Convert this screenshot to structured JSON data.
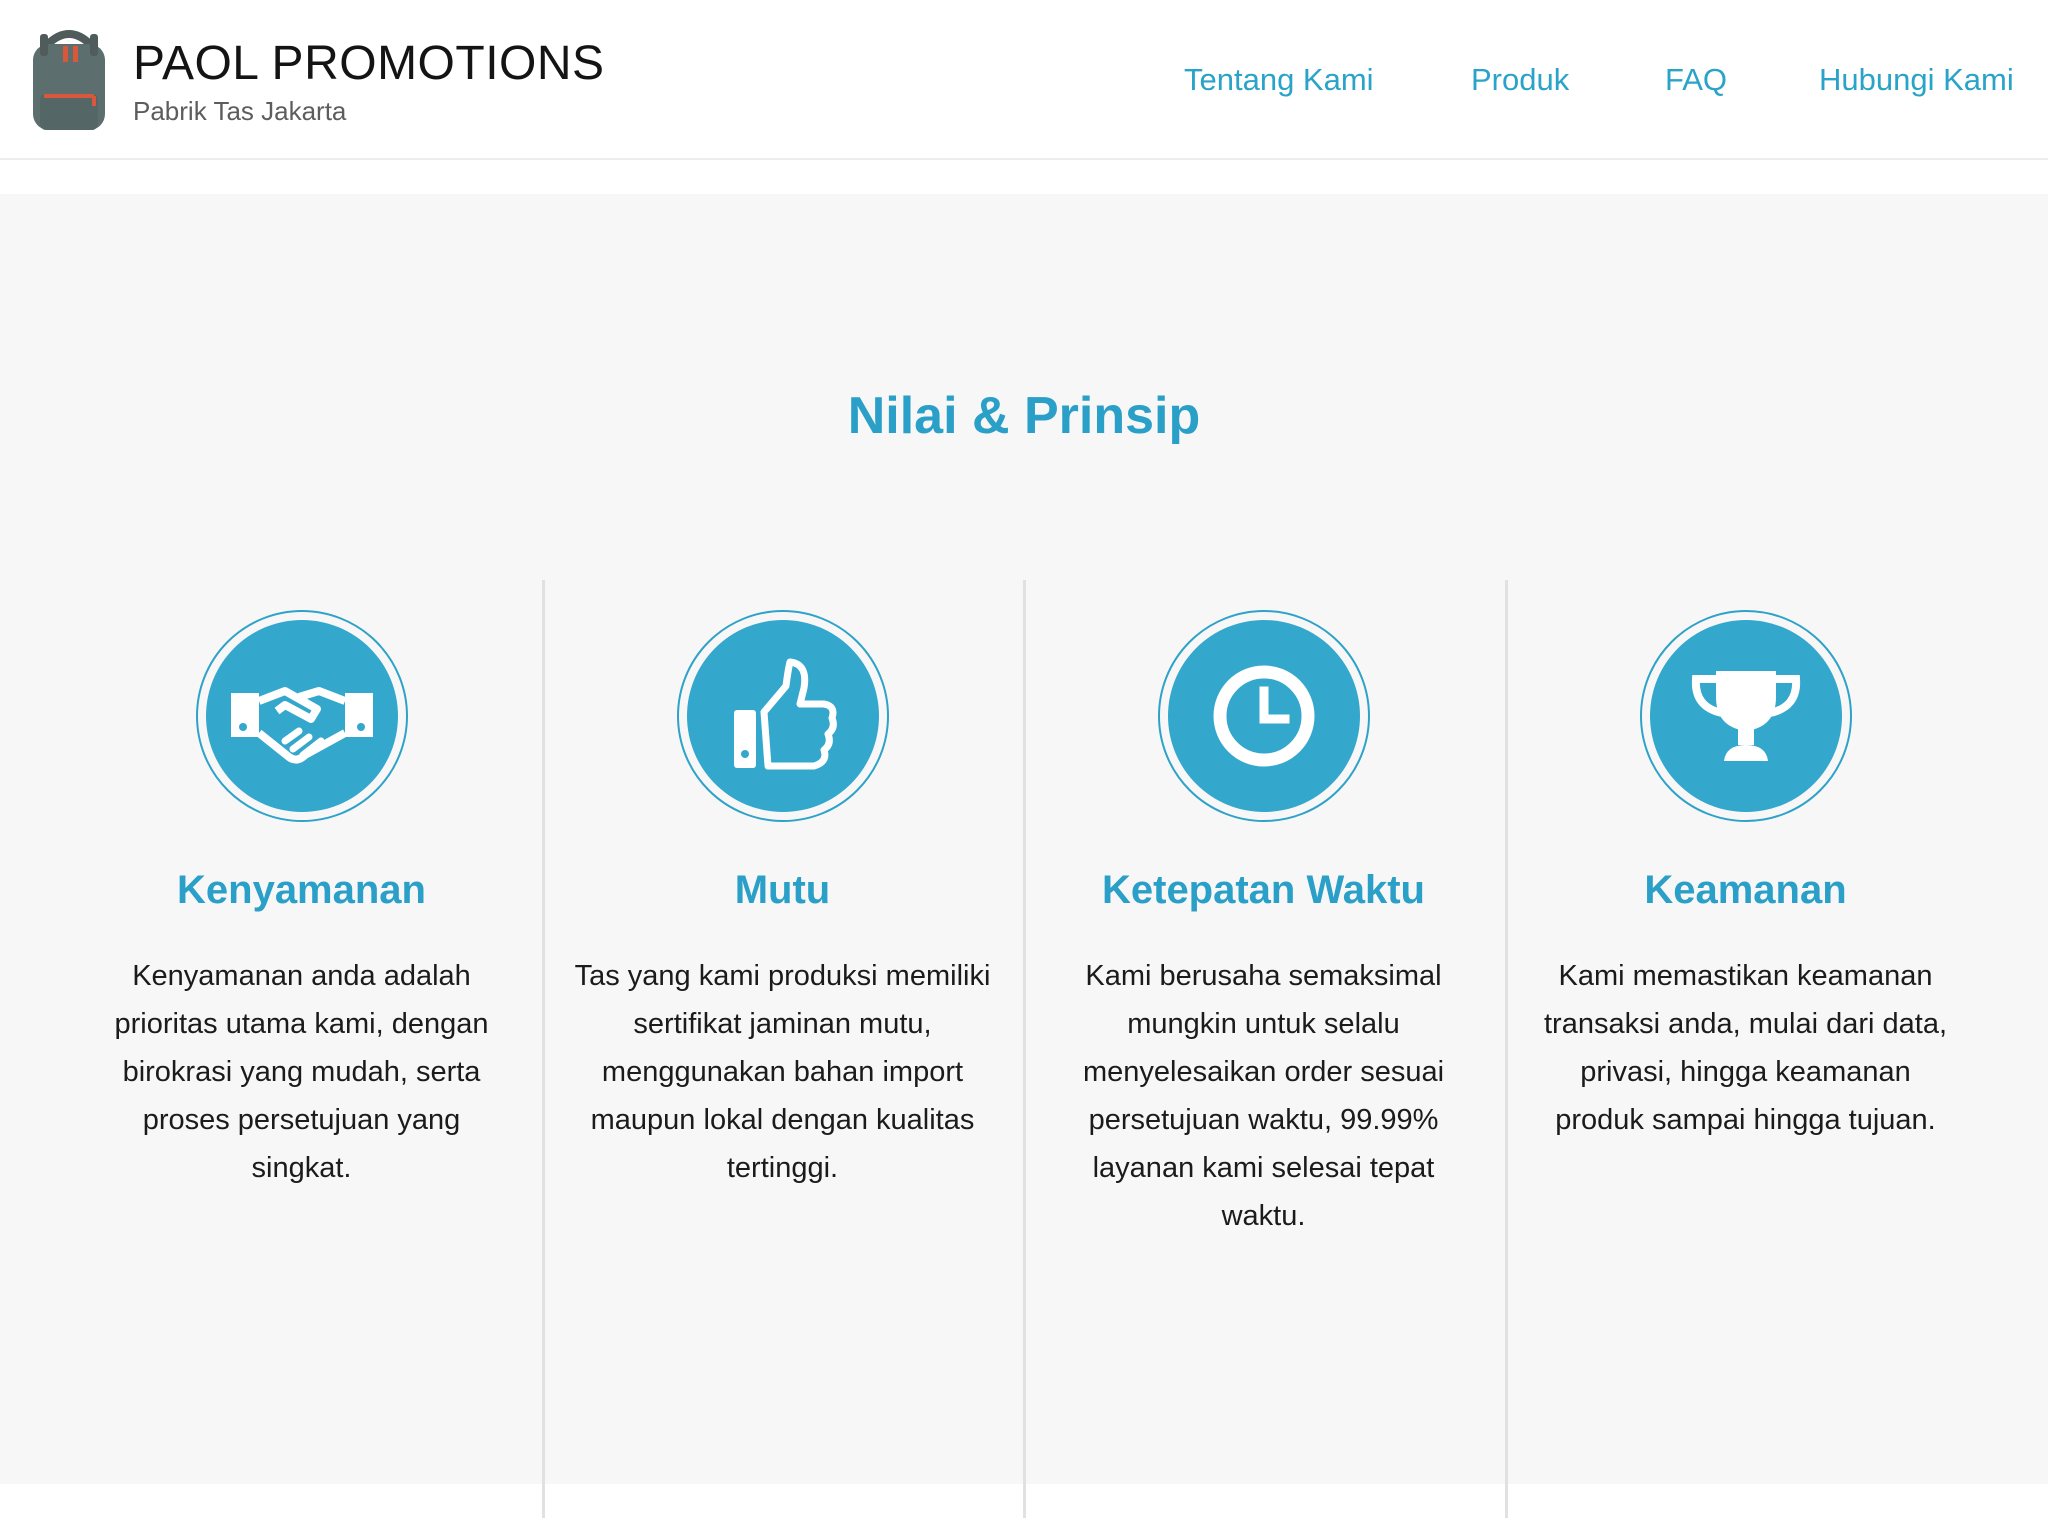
{
  "brand": {
    "title": "PAOL PROMOTIONS",
    "subtitle": "Pabrik Tas Jakarta",
    "logo_icon": "backpack-icon"
  },
  "nav": {
    "items": [
      {
        "label": "Tentang Kami"
      },
      {
        "label": "Produk"
      },
      {
        "label": "FAQ"
      },
      {
        "label": "Hubungi Kami"
      }
    ]
  },
  "section": {
    "title": "Nilai & Prinsip",
    "values": [
      {
        "icon": "handshake-icon",
        "title": "Kenyamanan",
        "text": "Kenyamanan anda adalah prioritas utama kami, dengan birokrasi yang mudah, serta proses persetujuan yang singkat."
      },
      {
        "icon": "thumbs-up-icon",
        "title": "Mutu",
        "text": "Tas yang kami produksi memiliki sertifikat jaminan mutu, menggunakan bahan import maupun lokal dengan kualitas tertinggi."
      },
      {
        "icon": "clock-icon",
        "title": "Ketepatan Waktu",
        "text": "Kami berusaha semaksimal mungkin untuk selalu menyelesaikan order sesuai persetujuan waktu, 99.99% layanan kami selesai tepat waktu."
      },
      {
        "icon": "trophy-icon",
        "title": "Keamanan",
        "text": "Kami memastikan keamanan transaksi anda, mulai dari data, privasi, hingga keamanan produk sampai hingga tujuan."
      }
    ]
  },
  "colors": {
    "accent": "#2a9fc7",
    "icon_fill": "#34a7cd",
    "section_bg": "#f7f7f7",
    "text": "#1b1b1b"
  }
}
